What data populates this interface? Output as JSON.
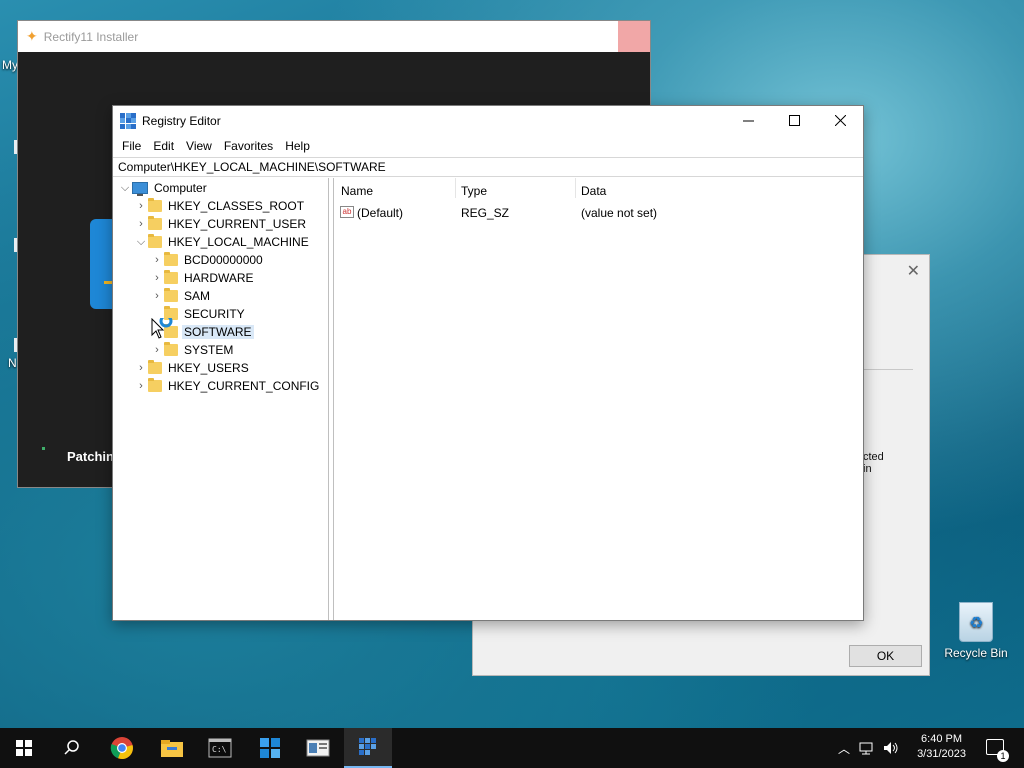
{
  "desktop": {
    "fragments": [
      "My",
      "N"
    ],
    "recycle_bin_label": "Recycle Bin"
  },
  "installer": {
    "title": "Rectify11 Installer",
    "status_text": "Patchin"
  },
  "dialog2": {
    "fragment_text": "cted\nin",
    "ok_label": "OK"
  },
  "regedit": {
    "title": "Registry Editor",
    "menu": [
      "File",
      "Edit",
      "View",
      "Favorites",
      "Help"
    ],
    "address": "Computer\\HKEY_LOCAL_MACHINE\\SOFTWARE",
    "tree": {
      "root": "Computer",
      "hives": [
        "HKEY_CLASSES_ROOT",
        "HKEY_CURRENT_USER",
        "HKEY_LOCAL_MACHINE",
        "HKEY_USERS",
        "HKEY_CURRENT_CONFIG"
      ],
      "hklm_children": [
        "BCD00000000",
        "HARDWARE",
        "SAM",
        "SECURITY",
        "SOFTWARE",
        "SYSTEM"
      ],
      "selected": "SOFTWARE"
    },
    "columns": [
      "Name",
      "Type",
      "Data"
    ],
    "values": [
      {
        "name": "(Default)",
        "type": "REG_SZ",
        "data": "(value not set)"
      }
    ]
  },
  "taskbar": {
    "time": "6:40 PM",
    "date": "3/31/2023",
    "notification_count": "1",
    "icons": [
      "start-icon",
      "search-icon",
      "chrome-icon",
      "file-explorer-icon",
      "terminal-icon",
      "rectify11-icon",
      "control-panel-icon",
      "registry-editor-icon"
    ]
  },
  "colors": {
    "accent": "#77b7f2",
    "selection": "#d9e8f7",
    "folder": "#f6cf61"
  }
}
